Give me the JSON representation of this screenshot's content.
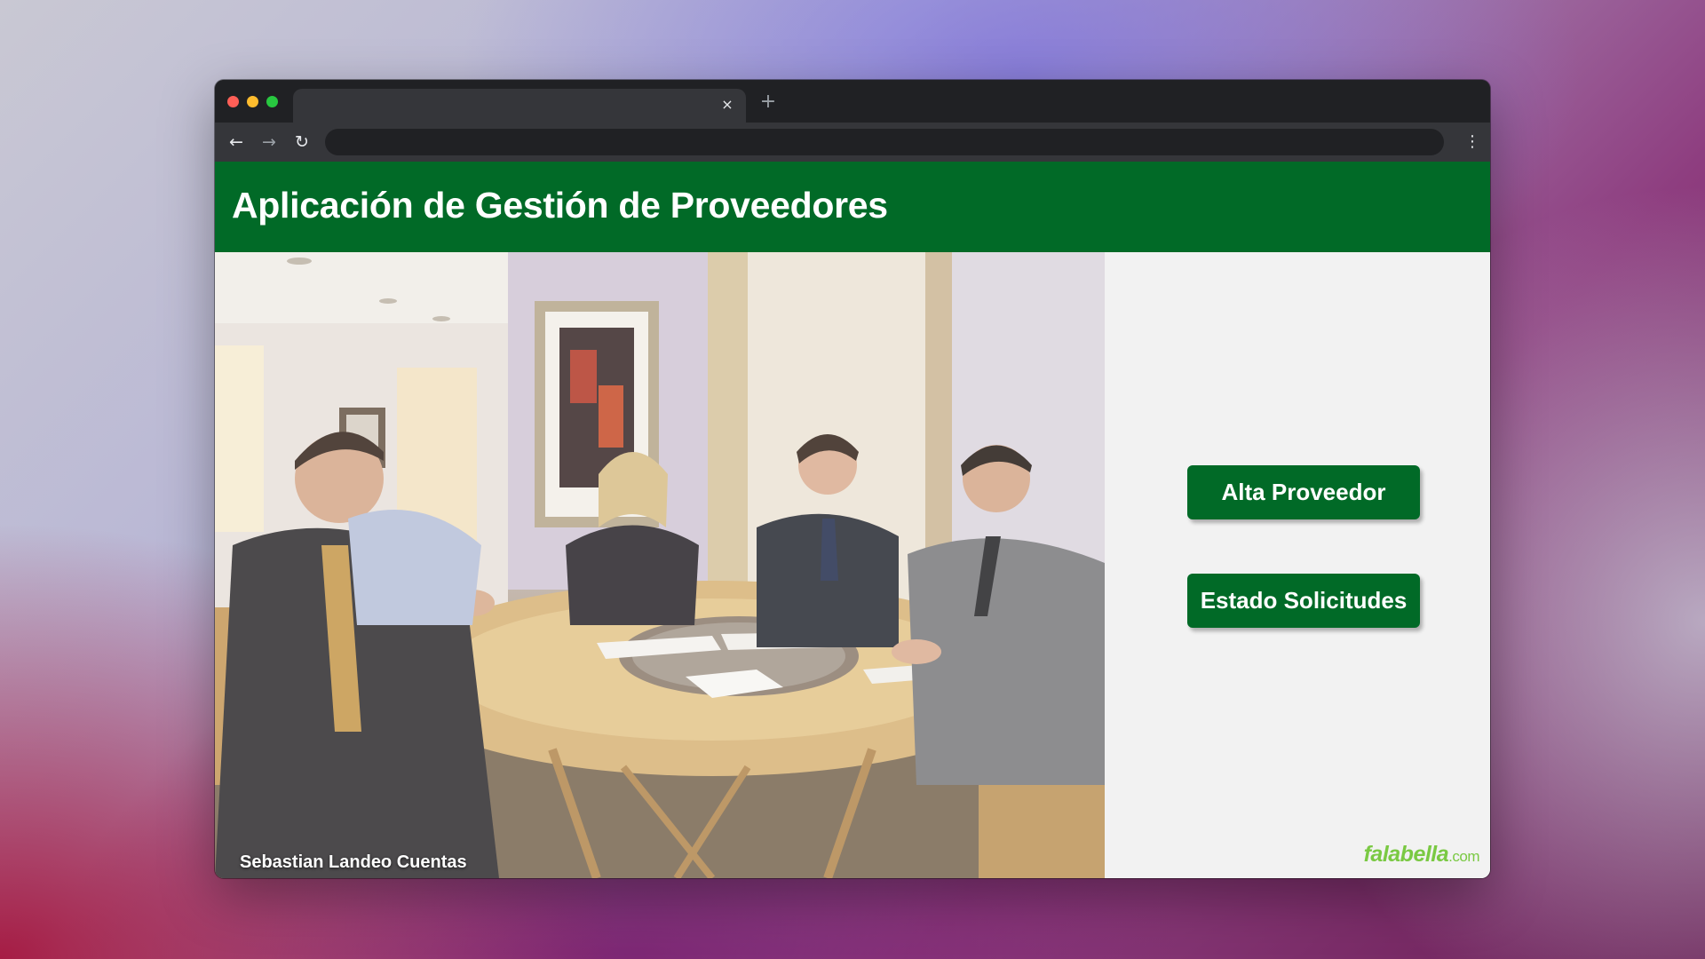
{
  "browser": {
    "tab_close_glyph": "×",
    "new_tab_glyph": "+",
    "back_glyph": "←",
    "forward_glyph": "→",
    "reload_glyph": "↻",
    "menu_glyph": "⋮",
    "address": ""
  },
  "app": {
    "title": "Aplicación de Gestión de Proveedores",
    "header_color": "#016a27",
    "photo_caption": "Sebastian Landeo Cuentas",
    "buttons": {
      "alta_label": "Alta Proveedor",
      "estado_label": "Estado Solicitudes"
    },
    "brand": {
      "name": "falabella",
      "suffix": ".com",
      "color": "#7ac943"
    }
  }
}
